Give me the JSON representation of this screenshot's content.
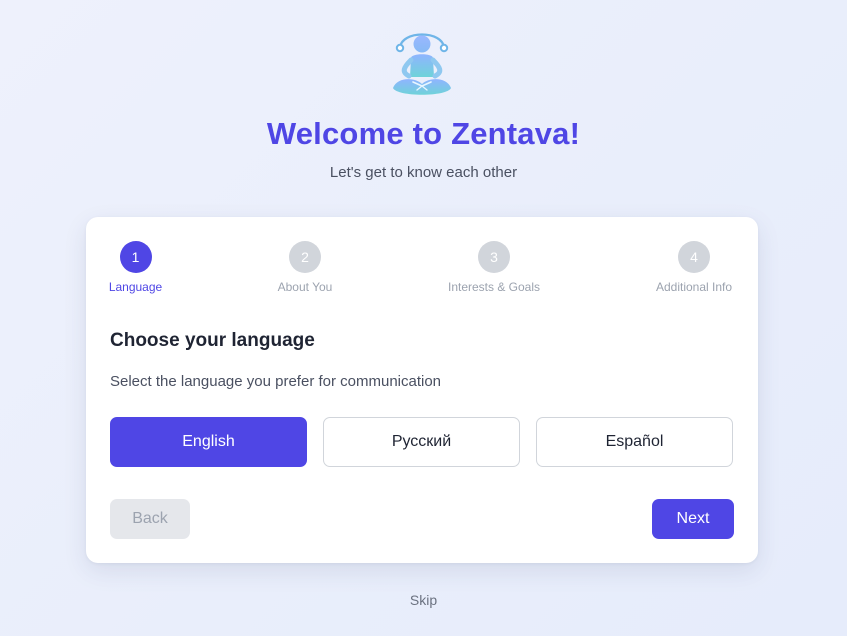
{
  "header": {
    "logo_icon": "meditation-person-icon",
    "title": "Welcome to Zentava!",
    "subtitle": "Let's get to know each other"
  },
  "stepper": {
    "current_step": 1,
    "steps": [
      {
        "number": "1",
        "label": "Language"
      },
      {
        "number": "2",
        "label": "About You"
      },
      {
        "number": "3",
        "label": "Interests & Goals"
      },
      {
        "number": "4",
        "label": "Additional Info"
      }
    ]
  },
  "language_step": {
    "title": "Choose your language",
    "description": "Select the language you prefer for communication",
    "selected": "English",
    "options": [
      {
        "label": "English"
      },
      {
        "label": "Русский"
      },
      {
        "label": "Español"
      }
    ]
  },
  "actions": {
    "back_label": "Back",
    "next_label": "Next",
    "skip_label": "Skip"
  },
  "colors": {
    "accent": "#4f46e5",
    "inactive_step": "#d1d5db",
    "disabled_button": "#e5e7eb",
    "background": "#eef1fc"
  }
}
